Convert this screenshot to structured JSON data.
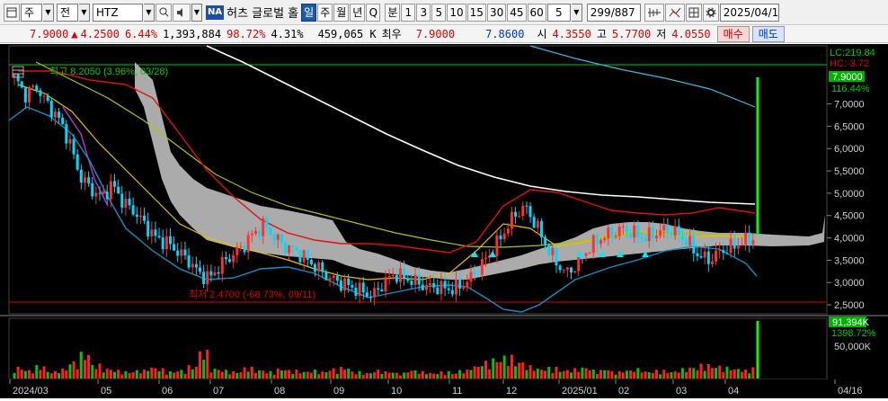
{
  "toolbar": {
    "type_label": "주",
    "sub_label": "전",
    "ticker": "HTZ",
    "stock_name": "허츠 글로벌 홀",
    "na_badge": "NA",
    "period_day": "일",
    "period_week": "주",
    "period_month": "월",
    "period_year": "년",
    "period_quarter": "Q",
    "period_minute": "분",
    "intervals": [
      "1",
      "3",
      "5",
      "10",
      "15",
      "30",
      "45",
      "60",
      "5"
    ],
    "count": "299",
    "count_total": "887",
    "date": "2025/04/1"
  },
  "quote": {
    "price": "7.9000",
    "change_arrow": "▲",
    "change": "4.2500",
    "change_pct": "6.44%",
    "volume": "1,393,884",
    "vol_ratio": "98.72%",
    "turnover": "4.31%",
    "amount": "459,065 K",
    "best_label": "최우",
    "ask": "7.9000",
    "bid": "7.8600",
    "open_label": "시",
    "open": "4.3550",
    "high_label": "고",
    "high": "5.7700",
    "low_label": "저",
    "low": "4.0550",
    "buy_label": "매수",
    "sell_label": "매도"
  },
  "chart": {
    "max_label": "최고 8.2050 (3.96%, 03/28)",
    "min_label": "최저 2.4700 (-68.73%, 09/11)",
    "lc_label": "LC:219.84",
    "hc_label": "HC:-3.72",
    "cur_price_tag": "7.9000",
    "cur_pct_tag": "116.44%",
    "vol_tag": "91,394K",
    "vol_pct_tag": "1398.72%",
    "vol_axis_label": "50,000K",
    "colors": {
      "ma_white": "#ffffff",
      "ma_red": "#e01010",
      "ma_yellow": "#e8c000",
      "ma_olive": "#a8c800",
      "ma_cyan": "#40b8d8",
      "bollinger": "#1090c0",
      "cloud": "#b4b4b4",
      "up": "#ff3030",
      "down": "#00d8ff",
      "volume_up": "#ff2020",
      "volume_main": "#00c800"
    }
  },
  "chart_data": {
    "type": "candlestick",
    "title": "HTZ",
    "y_axis_ticks": [
      "7,0000",
      "6,5000",
      "6,0000",
      "5,5000",
      "5,0000",
      "4,5000",
      "4,0000",
      "3,5000",
      "3,0000",
      "2,5000"
    ],
    "x_axis_ticks": [
      "2024/03",
      "05",
      "06",
      "07",
      "08",
      "09",
      "10",
      "11",
      "12",
      "2025/01",
      "02",
      "03",
      "04",
      "04/16"
    ],
    "ylim": [
      2.3,
      8.3
    ],
    "close_series": [
      7.6,
      7.2,
      7.4,
      7.0,
      6.7,
      6.2,
      5.4,
      5.1,
      4.9,
      5.2,
      4.8,
      4.6,
      4.3,
      4.0,
      3.9,
      3.7,
      3.5,
      3.2,
      3.1,
      3.4,
      3.6,
      3.8,
      4.1,
      4.3,
      4.0,
      3.8,
      3.7,
      3.5,
      3.3,
      3.1,
      3.0,
      2.9,
      2.8,
      2.7,
      3.0,
      3.2,
      3.1,
      3.0,
      2.9,
      2.9,
      2.85,
      2.9,
      3.1,
      3.4,
      3.7,
      4.1,
      4.5,
      4.7,
      4.3,
      3.8,
      3.4,
      3.2,
      3.5,
      3.8,
      4.0,
      4.1,
      4.2,
      4.1,
      4.0,
      4.1,
      4.2,
      4.1,
      3.9,
      3.6,
      3.5,
      3.7,
      3.8,
      3.9,
      4.0,
      7.9
    ],
    "volume_series": [
      8,
      6,
      9,
      5,
      7,
      12,
      18,
      10,
      7,
      6,
      5,
      6,
      8,
      7,
      5,
      6,
      9,
      20,
      7,
      6,
      5,
      8,
      6,
      5,
      7,
      6,
      5,
      6,
      5,
      7,
      8,
      5,
      4,
      6,
      5,
      4,
      6,
      5,
      4,
      5,
      4,
      6,
      9,
      12,
      14,
      16,
      12,
      9,
      7,
      8,
      6,
      7,
      8,
      6,
      7,
      5,
      6,
      7,
      5,
      6,
      5,
      7,
      8,
      10,
      9,
      8,
      7,
      6,
      8,
      91
    ]
  }
}
